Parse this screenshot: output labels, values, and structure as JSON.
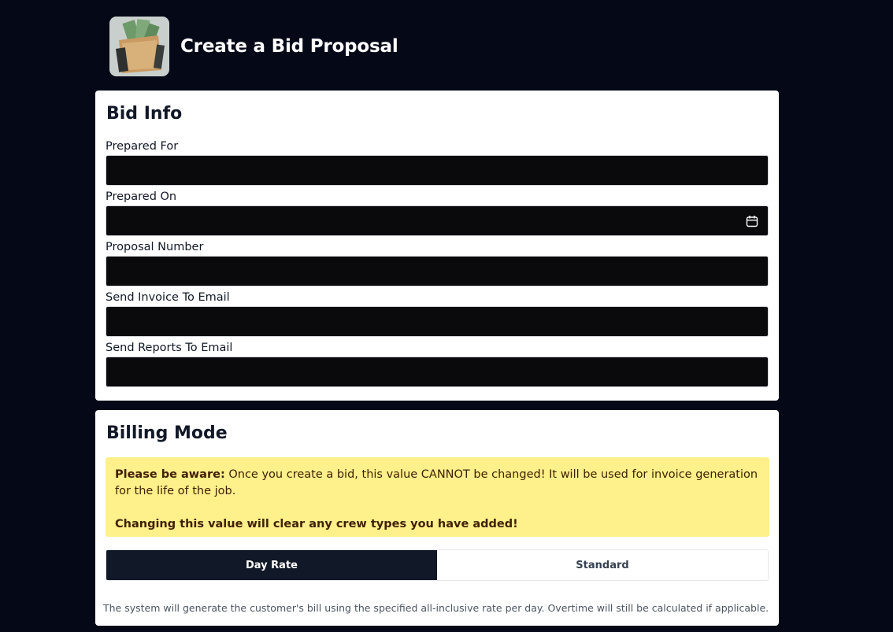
{
  "header": {
    "title": "Create a Bid Proposal",
    "logo_icon": "money-folder-icon"
  },
  "bid_info": {
    "title": "Bid Info",
    "fields": [
      {
        "label": "Prepared For",
        "value": "",
        "placeholder": ""
      },
      {
        "label": "Prepared On",
        "value": "",
        "placeholder": ""
      },
      {
        "label": "Proposal Number",
        "value": "",
        "placeholder": ""
      },
      {
        "label": "Send Invoice To Email",
        "value": "",
        "placeholder": ""
      },
      {
        "label": "Send Reports To Email",
        "value": "",
        "placeholder": ""
      }
    ],
    "calendar_icon": "calendar-icon"
  },
  "billing_mode": {
    "title": "Billing Mode",
    "notice": {
      "bold_prefix": "Please be aware:",
      "text": " Once you create a bid, this value CANNOT be changed! It will be used for invoice generation for the life of the job.",
      "warning": "Changing this value will clear any crew types you have added!"
    },
    "options": [
      "Day Rate",
      "Standard"
    ],
    "selected": "Day Rate",
    "help_text": "The system will generate the customer's bill using the specified all-inclusive rate per day. Overtime will still be calculated if applicable."
  },
  "colors": {
    "background": "#040817",
    "card": "#ffffff",
    "input": "#0a0a0c",
    "notice_bg": "#fef08a",
    "active_toggle": "#111827"
  }
}
